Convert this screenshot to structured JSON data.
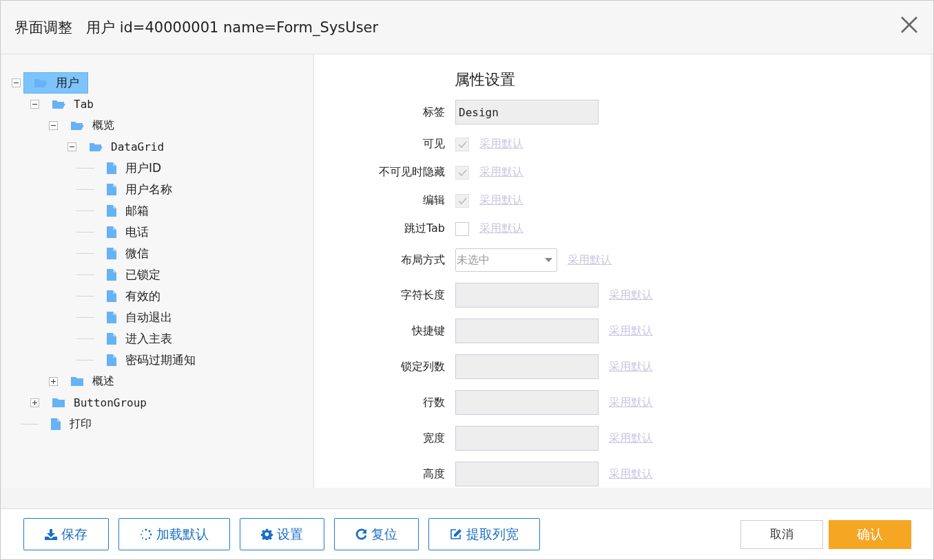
{
  "window": {
    "title": "界面调整   用户 id=40000001 name=Form_SysUser"
  },
  "tree": [
    {
      "label": "用户",
      "kind": "folder",
      "expanded": true,
      "selected": true,
      "children": [
        {
          "label": "Tab",
          "kind": "folder",
          "expanded": true,
          "selected": false,
          "children": [
            {
              "label": "概览",
              "kind": "folder",
              "expanded": true,
              "selected": false,
              "children": [
                {
                  "label": "DataGrid",
                  "kind": "folder",
                  "expanded": true,
                  "selected": false,
                  "children": [
                    {
                      "label": "用户ID",
                      "kind": "file",
                      "selected": false
                    },
                    {
                      "label": "用户名称",
                      "kind": "file",
                      "selected": false
                    },
                    {
                      "label": "邮箱",
                      "kind": "file",
                      "selected": false
                    },
                    {
                      "label": "电话",
                      "kind": "file",
                      "selected": false
                    },
                    {
                      "label": "微信",
                      "kind": "file",
                      "selected": false
                    },
                    {
                      "label": "已锁定",
                      "kind": "file",
                      "selected": false
                    },
                    {
                      "label": "有效的",
                      "kind": "file",
                      "selected": false
                    },
                    {
                      "label": "自动退出",
                      "kind": "file",
                      "selected": false
                    },
                    {
                      "label": "进入主表",
                      "kind": "file",
                      "selected": false
                    },
                    {
                      "label": "密码过期通知",
                      "kind": "file",
                      "selected": false
                    }
                  ]
                }
              ]
            },
            {
              "label": "概述",
              "kind": "folder",
              "expanded": false,
              "selected": false
            }
          ]
        },
        {
          "label": "ButtonGroup",
          "kind": "folder",
          "expanded": false,
          "selected": false
        },
        {
          "label": "打印",
          "kind": "file",
          "selected": false
        }
      ]
    }
  ],
  "properties": {
    "title": "属性设置",
    "fields": [
      {
        "label": "标签",
        "kind": "text",
        "value": "Design"
      },
      {
        "label": "可见",
        "kind": "checkbox",
        "checked": true,
        "disabled": true,
        "default_link": "采用默认"
      },
      {
        "label": "不可见时隐藏",
        "kind": "checkbox",
        "checked": true,
        "disabled": true,
        "default_link": "采用默认"
      },
      {
        "label": "编辑",
        "kind": "checkbox",
        "checked": true,
        "disabled": true,
        "default_link": "采用默认"
      },
      {
        "label": "跳过Tab",
        "kind": "checkbox",
        "checked": false,
        "disabled": false,
        "default_link": "采用默认"
      },
      {
        "label": "布局方式",
        "kind": "select",
        "placeholder": "未选中",
        "default_link": "采用默认"
      },
      {
        "label": "字符长度",
        "kind": "text",
        "default_link": "采用默认"
      },
      {
        "label": "快捷键",
        "kind": "text",
        "default_link": "采用默认"
      },
      {
        "label": "锁定列数",
        "kind": "text",
        "default_link": "采用默认"
      },
      {
        "label": "行数",
        "kind": "text",
        "default_link": "采用默认"
      },
      {
        "label": "宽度",
        "kind": "text",
        "default_link": "采用默认"
      },
      {
        "label": "高度",
        "kind": "text",
        "default_link": "采用默认"
      }
    ]
  },
  "footer": {
    "left_buttons": [
      {
        "label": "保存"
      },
      {
        "label": "加载默认"
      },
      {
        "label": "设置"
      },
      {
        "label": "复位"
      },
      {
        "label": "提取列宽"
      }
    ],
    "cancel": "取消",
    "confirm": "确认"
  }
}
